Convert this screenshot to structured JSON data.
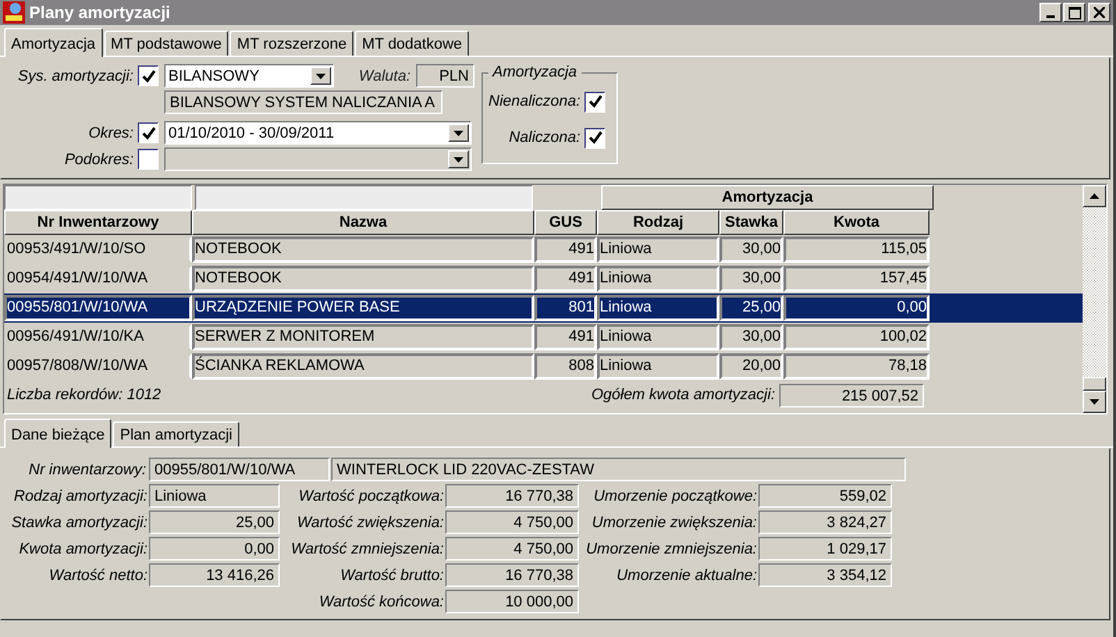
{
  "window": {
    "title": "Plany amortyzacji"
  },
  "tabs": [
    {
      "label": "Amortyzacja",
      "selected": true
    },
    {
      "label": "MT podstawowe",
      "selected": false
    },
    {
      "label": "MT rozszerzone",
      "selected": false
    },
    {
      "label": "MT dodatkowe",
      "selected": false
    }
  ],
  "filters": {
    "sys": {
      "label": "Sys. amortyzacji:",
      "checked": true,
      "value": "BILANSOWY",
      "description": "BILANSOWY SYSTEM NALICZANIA A"
    },
    "waluta": {
      "label": "Waluta:",
      "value": "PLN"
    },
    "okres": {
      "label": "Okres:",
      "checked": true,
      "value": "01/10/2010 - 30/09/2011"
    },
    "podokres": {
      "label": "Podokres:",
      "checked": false
    }
  },
  "amortyzacja_group": {
    "title": "Amortyzacja",
    "items": [
      {
        "label": "Nienaliczona:",
        "checked": true
      },
      {
        "label": "Naliczona:",
        "checked": true
      }
    ]
  },
  "table": {
    "group_header": "Amortyzacja",
    "columns": [
      "Nr Inwentarzowy",
      "Nazwa",
      "GUS",
      "Rodzaj",
      "Stawka",
      "Kwota"
    ],
    "rows": [
      {
        "selected": false,
        "cells": [
          "00953/491/W/10/SO",
          "NOTEBOOK",
          "491",
          "Liniowa",
          "30,00",
          "115,05"
        ]
      },
      {
        "selected": false,
        "cells": [
          "00954/491/W/10/WA",
          "NOTEBOOK",
          "491",
          "Liniowa",
          "30,00",
          "157,45"
        ]
      },
      {
        "selected": true,
        "cells": [
          "00955/801/W/10/WA",
          "URZĄDZENIE POWER BASE",
          "801",
          "Liniowa",
          "25,00",
          "0,00"
        ]
      },
      {
        "selected": false,
        "cells": [
          "00956/491/W/10/KA",
          "SERWER Z MONITOREM",
          "491",
          "Liniowa",
          "30,00",
          "100,02"
        ]
      },
      {
        "selected": false,
        "cells": [
          "00957/808/W/10/WA",
          "ŚCIANKA REKLAMOWA",
          "808",
          "Liniowa",
          "20,00",
          "78,18"
        ]
      }
    ],
    "record_count": "Liczba rekordów: 1012",
    "total_label": "Ogółem kwota amortyzacji:",
    "total_value": "215 007,52"
  },
  "detail_tabs": [
    {
      "label": "Dane bieżące",
      "selected": true
    },
    {
      "label": "Plan amortyzacji",
      "selected": false
    }
  ],
  "detail": {
    "inventory": {
      "label": "Nr inwentarzowy:",
      "value": "00955/801/W/10/WA",
      "name": "WINTERLOCK LID 220VAC-ZESTAW"
    },
    "columns": [
      [
        {
          "label": "Rodzaj amortyzacji:",
          "value": "Liniowa",
          "kind": "text"
        },
        {
          "label": "Stawka amortyzacji:",
          "value": "25,00",
          "kind": "number"
        },
        {
          "label": "Kwota amortyzacji:",
          "value": "0,00",
          "kind": "number"
        },
        {
          "label": "Wartość netto:",
          "value": "13 416,26",
          "kind": "number"
        }
      ],
      [
        {
          "label": "Wartość początkowa:",
          "value": "16 770,38",
          "kind": "number"
        },
        {
          "label": "Wartość zwiększenia:",
          "value": "4 750,00",
          "kind": "number"
        },
        {
          "label": "Wartość zmniejszenia:",
          "value": "4 750,00",
          "kind": "number"
        },
        {
          "label": "Wartość brutto:",
          "value": "16 770,38",
          "kind": "number"
        },
        {
          "label": "Wartość końcowa:",
          "value": "10 000,00",
          "kind": "number"
        }
      ],
      [
        {
          "label": "Umorzenie początkowe:",
          "value": "559,02",
          "kind": "number"
        },
        {
          "label": "Umorzenie zwiększenia:",
          "value": "3 824,27",
          "kind": "number"
        },
        {
          "label": "Umorzenie zmniejszenia:",
          "value": "1 029,17",
          "kind": "number"
        },
        {
          "label": "Umorzenie aktualne:",
          "value": "3 354,12",
          "kind": "number"
        }
      ]
    ]
  }
}
